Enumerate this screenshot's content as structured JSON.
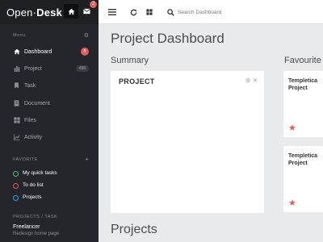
{
  "brand": {
    "logo_light": "Open",
    "logo_bold": "Desk",
    "mail_badge": "2"
  },
  "sidebar": {
    "menu_label": "Menu",
    "items": [
      {
        "label": "Dashboard",
        "icon": "home-icon",
        "badge": "5"
      },
      {
        "label": "Project",
        "icon": "bar-chart-icon",
        "badge": "456"
      },
      {
        "label": "Task",
        "icon": "bookmark-icon"
      },
      {
        "label": "Document",
        "icon": "document-icon"
      },
      {
        "label": "Files",
        "icon": "grid-icon"
      },
      {
        "label": "Activity",
        "icon": "activity-icon"
      }
    ],
    "favorite_label": "FAVORITE",
    "favorite_add": "+",
    "favorites": [
      {
        "label": "My quick tasks",
        "color": "#4cc36a"
      },
      {
        "label": "To do list",
        "color": "#e25a5a"
      },
      {
        "label": "Projects",
        "color": "#3a9ee4"
      }
    ],
    "projects_task_label": "PROJECTS / TASK",
    "project_task": {
      "title": "Freelancer",
      "subtitle": "Redesign home page"
    }
  },
  "topbar": {
    "search_placeholder": "Search Dashboard"
  },
  "main": {
    "page_title": "Project Dashboard",
    "summary_title": "Summary",
    "summary_card_title": "PROJECT",
    "favourites_title": "Favourite",
    "favourite_cards": [
      {
        "title": "Templetica Project"
      },
      {
        "title": "Templetica Project"
      }
    ],
    "projects_title": "Projects"
  },
  "colors": {
    "accent_red": "#e25a5a",
    "sidebar_bg": "#24262b",
    "green": "#4cc36a",
    "blue": "#3a9ee4"
  }
}
